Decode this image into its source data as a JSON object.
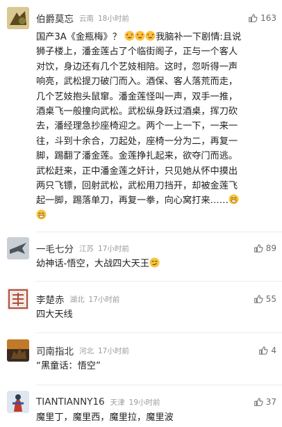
{
  "comments": [
    {
      "username": "伯爵莫忘",
      "location": "云南",
      "time": "18小时前",
      "likes": "163",
      "lines": [
        "国产3A《金瓶梅》？",
        "我脑补一下剧情:且说",
        "狮子楼上，潘金莲占了个临街阁子，正与一个客人",
        "对饮，身边还有几个艺妓相陪。这时，忽听得一声",
        "响亮，武松提刀破门而入。酒保、客人落荒而走，",
        "几个艺妓抱头鼠窜。潘金莲怪叫一声，双手一推，",
        "酒桌飞一般撞向武松。武松纵身跃过酒桌，挥刀砍",
        "去，潘经理急抄座椅迎之。两个一上一下，一来一",
        "往，斗到十余合，刀起处，座椅一分为二，再复一",
        "脚，踢翻了潘金莲。金莲挣扎起来，欲夺门而逃。",
        "武松赶来，正中潘金莲之奸计，只见她从怀中摸出",
        "两只飞镖，回射武松，武松用刀挡开，却被金莲飞",
        "起一脚，踢落单刀，再复一拳，向心窝打来……"
      ]
    },
    {
      "username": "一毛七分",
      "location": "江苏",
      "time": "17小时前",
      "likes": "89",
      "lines": [
        "幼神话-悟空，大战四大天王"
      ]
    },
    {
      "username": "李楚赤",
      "location": "湖北",
      "time": "17小时前",
      "likes": "55",
      "lines": [
        "四大天线"
      ]
    },
    {
      "username": "司南指北",
      "location": "河北",
      "time": "17小时前",
      "likes": "4",
      "lines": [
        "“黑童话：悟空”"
      ]
    },
    {
      "username": "TIANTIANNY16",
      "location": "天津",
      "time": "19小时前",
      "likes": "37",
      "lines": [
        "魔里丁，魔里西，魔里拉，魔里波"
      ]
    }
  ],
  "icons": {
    "like": "thumbs-up-icon",
    "emoji_heart_eyes": "heart-eyes-emoji",
    "emoji_grin_sweat": "grinning-sweat-emoji",
    "emoji_smirk": "smirk-emoji"
  }
}
